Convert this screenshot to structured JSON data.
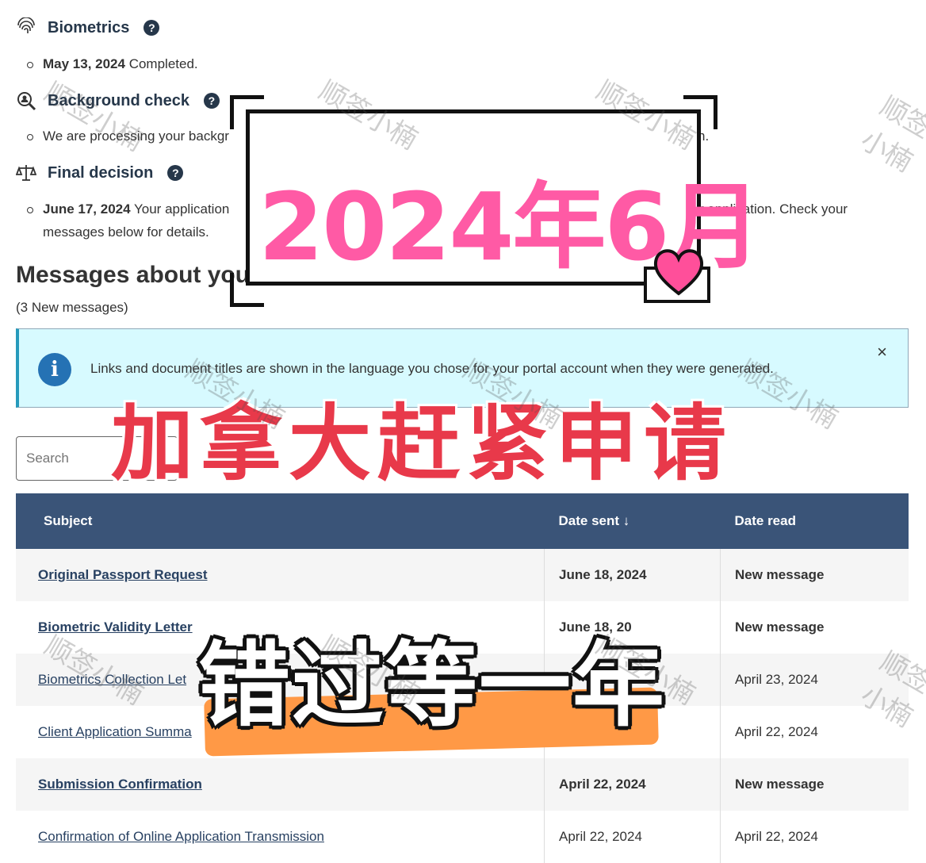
{
  "steps": [
    {
      "title": "Biometrics",
      "icon": "fingerprint-icon",
      "date": "May 13, 2024",
      "text": " Completed."
    },
    {
      "title": "Background check",
      "icon": "magnifier-person-icon",
      "date": "",
      "text": "We are processing your backgr"
    },
    {
      "title": "Final decision",
      "icon": "scales-icon",
      "date": "June 17, 2024",
      "text": " Your application",
      "text_right": "r application. Check your",
      "text2": "messages below for details."
    }
  ],
  "help_glyph": "?",
  "background_suffix": "n.",
  "messages": {
    "title": "Messages about you",
    "count": "(3 New messages)"
  },
  "info_banner": {
    "icon_glyph": "i",
    "text": "Links and document titles are shown in the language you chose for your portal account when they were generated.",
    "close_glyph": "×"
  },
  "search": {
    "placeholder": "Search"
  },
  "table": {
    "headers": {
      "subject": "Subject",
      "date_sent": "Date sent ↓",
      "date_read": "Date read"
    },
    "rows": [
      {
        "subject": "Original Passport Request",
        "sent": "June 18, 2024",
        "read": "New message",
        "new": true
      },
      {
        "subject": "Biometric Validity Letter",
        "sent": "June 18, 20",
        "read": "New message",
        "new": true
      },
      {
        "subject": "Biometrics Collection Let",
        "sent": "",
        "read": "April 23, 2024",
        "new": false
      },
      {
        "subject": "Client Application Summa",
        "sent": "",
        "read": "April 22, 2024",
        "new": false
      },
      {
        "subject": "Submission Confirmation",
        "sent": "April 22, 2024",
        "read": "New message",
        "new": true
      },
      {
        "subject": "Confirmation of Online Application Transmission",
        "sent": "April 22, 2024",
        "read": "April 22, 2024",
        "new": false
      }
    ]
  },
  "overlay": {
    "banner_date": "2024年6月",
    "headline": "加拿大赶紧申请",
    "sub_headline": "错过等一年",
    "watermark": "顺签小楠",
    "heart_color": "#ff4f9a",
    "accent_pink": "#ff5aa5",
    "accent_red": "#e8394a",
    "accent_orange": "#ff9946"
  }
}
